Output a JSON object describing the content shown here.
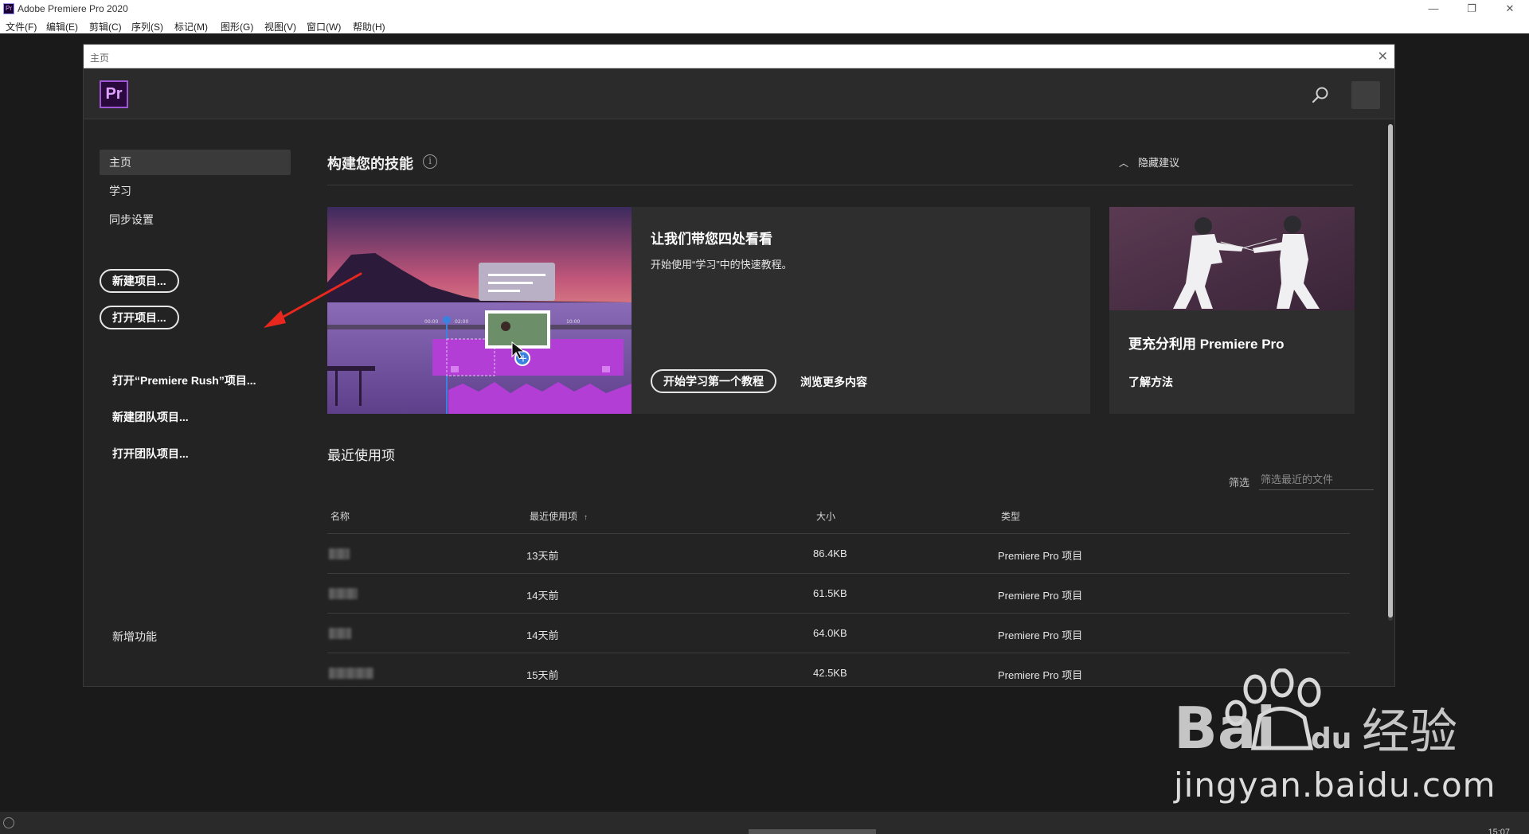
{
  "window": {
    "title": "Adobe Premiere Pro 2020",
    "app_icon": "Pr",
    "minimize": "—",
    "restore": "❐",
    "close": "✕"
  },
  "menu": [
    "文件(F)",
    "编辑(E)",
    "剪辑(C)",
    "序列(S)",
    "标记(M)",
    "图形(G)",
    "视图(V)",
    "窗口(W)",
    "帮助(H)"
  ],
  "dialog": {
    "title": "主页",
    "close": "✕",
    "logo": "Pr"
  },
  "sidebar": {
    "nav": [
      "主页",
      "学习",
      "同步设置"
    ],
    "new_project": "新建项目...",
    "open_project": "打开项目...",
    "open_rush": "打开“Premiere Rush”项目...",
    "new_team": "新建团队项目...",
    "open_team": "打开团队项目...",
    "whats_new": "新增功能"
  },
  "skills": {
    "title": "构建您的技能",
    "info_icon": "i",
    "hide": "隐藏建议",
    "tour_heading": "让我们带您四处看看",
    "tour_desc": "开始使用“学习”中的快速教程。",
    "tour_start": "开始学习第一个教程",
    "tour_more": "浏览更多内容",
    "pp_heading": "更充分利用 Premiere Pro",
    "pp_link": "了解方法"
  },
  "recent": {
    "title": "最近使用项",
    "filter_label": "筛选",
    "filter_placeholder": "筛选最近的文件",
    "columns": [
      "名称",
      "最近使用项",
      "大小",
      "类型"
    ],
    "sort_indicator": "↑",
    "rows": [
      {
        "name_hidden": true,
        "when": "13天前",
        "size": "86.4KB",
        "type": "Premiere Pro 项目"
      },
      {
        "name_hidden": true,
        "when": "14天前",
        "size": "61.5KB",
        "type": "Premiere Pro 项目"
      },
      {
        "name_hidden": true,
        "when": "14天前",
        "size": "64.0KB",
        "type": "Premiere Pro 项目"
      },
      {
        "name_hidden": true,
        "when": "15天前",
        "size": "42.5KB",
        "type": "Premiere Pro 项目"
      }
    ]
  },
  "watermark": {
    "brand": "Bai 经验",
    "url": "jingyan.baidu.com"
  },
  "status": {
    "clock": "15:07"
  },
  "colors": {
    "accent_pr": "#a056d6",
    "arrow": "#e8281e"
  }
}
